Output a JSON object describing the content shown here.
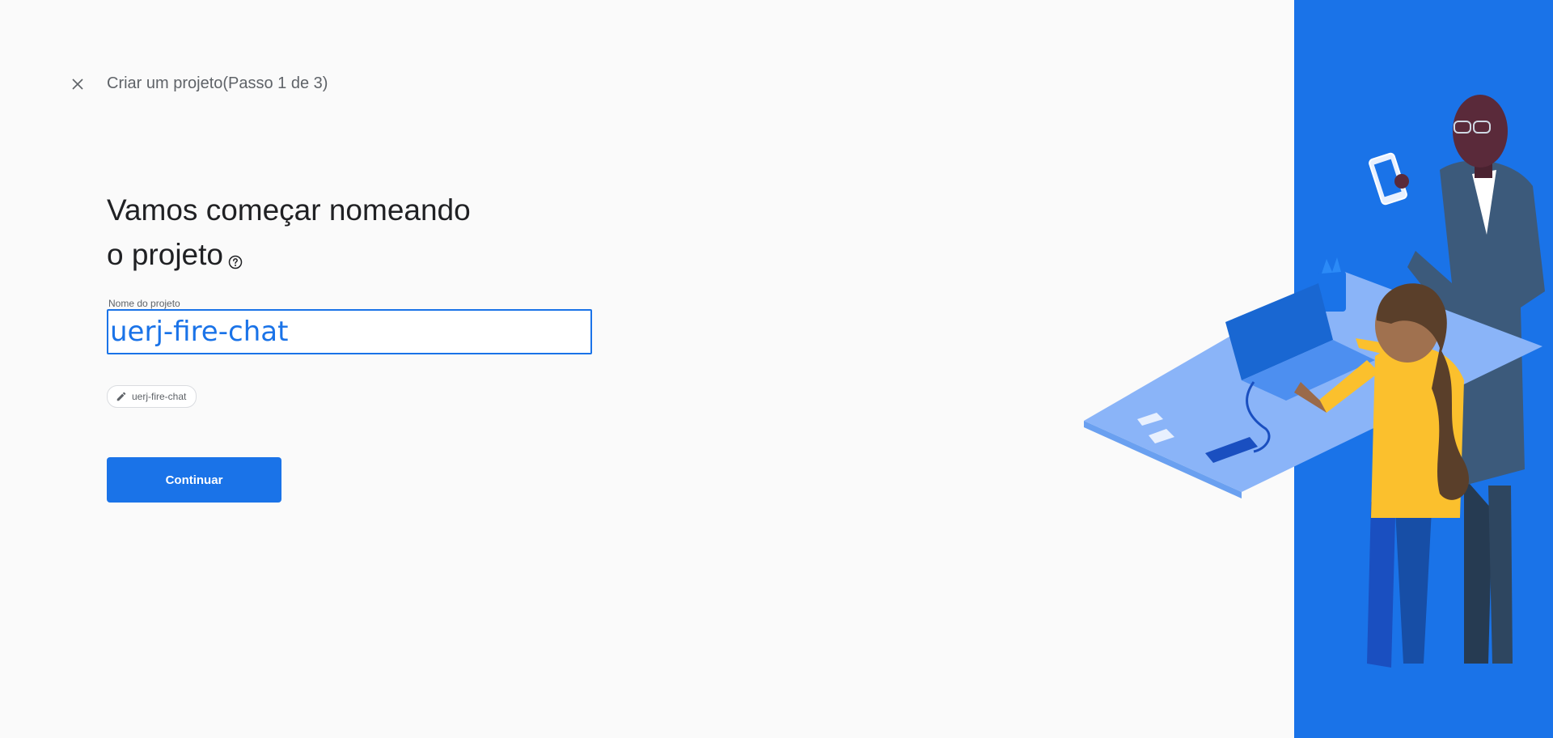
{
  "header": {
    "close_icon": "close-icon",
    "title": "Criar um projeto(Passo 1 de 3)"
  },
  "main": {
    "heading_line1": "Vamos começar nomeando",
    "heading_line2": "o projeto",
    "help_icon": "help-circle-icon",
    "field": {
      "label": "Nome do projeto",
      "value": "uerj-fire-chat"
    },
    "project_id_chip": {
      "icon": "pencil-icon",
      "label": "uerj-fire-chat"
    },
    "continue_label": "Continuar"
  },
  "colors": {
    "accent": "#1a73e8",
    "background": "#fafafa",
    "text_primary": "#202124",
    "text_secondary": "#5f6368"
  }
}
